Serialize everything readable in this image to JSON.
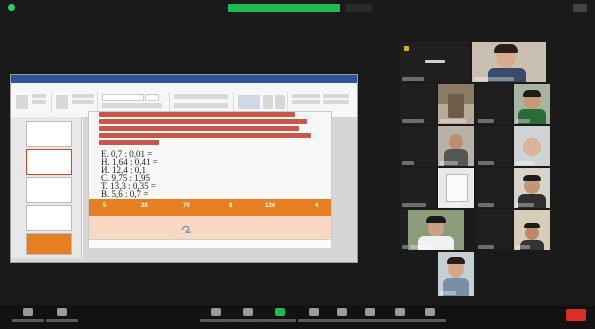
{
  "slide": {
    "equations": [
      "Е. 0,7 : 0,01 =",
      "Н. 1,64 : 0,41 =",
      "И. 12,4 : 0,1",
      "С. 9,75 : 1,95",
      "Т. 13,3 : 0,35 =",
      "В. 5,6 : 0,7 ="
    ],
    "answers": [
      "5",
      "38",
      "70",
      "8",
      "124",
      "4"
    ]
  },
  "colors": {
    "background": "#1a1a1a",
    "accent_green": "#1db954",
    "answer_strip": "#e67e22",
    "slide_red_text": "#c0392b",
    "end_button": "#d93025"
  }
}
